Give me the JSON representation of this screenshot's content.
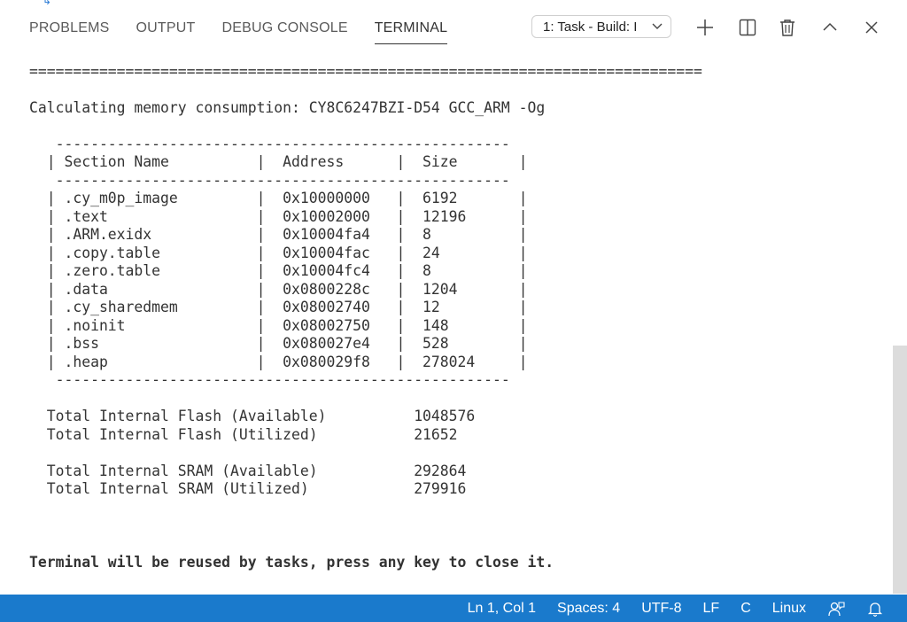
{
  "tabs": [
    {
      "label": "PROBLEMS"
    },
    {
      "label": "OUTPUT"
    },
    {
      "label": "DEBUG CONSOLE"
    },
    {
      "label": "TERMINAL"
    }
  ],
  "terminal_selector": {
    "value": "1: Task - Build: I"
  },
  "terminal_lines": [
    "=============================================================================",
    "Calculating memory consumption: CY8C6247BZI-D54 GCC_ARM -Og",
    "   ----------------------------------------------------",
    "  | Section Name          |  Address      |  Size       |",
    "   ----------------------------------------------------",
    "  | .cy_m0p_image         |  0x10000000   |  6192       |",
    "  | .text                 |  0x10002000   |  12196      |",
    "  | .ARM.exidx            |  0x10004fa4   |  8          |",
    "  | .copy.table           |  0x10004fac   |  24         |",
    "  | .zero.table           |  0x10004fc4   |  8          |",
    "  | .data                 |  0x0800228c   |  1204       |",
    "  | .cy_sharedmem         |  0x08002740   |  12         |",
    "  | .noinit               |  0x08002750   |  148        |",
    "  | .bss                  |  0x080027e4   |  528        |",
    "  | .heap                 |  0x080029f8   |  278024     |",
    "   ----------------------------------------------------",
    "  Total Internal Flash (Available)          1048576",
    "  Total Internal Flash (Utilized)           21652",
    "  Total Internal SRAM (Available)           292864",
    "  Total Internal SRAM (Utilized)            279916",
    "Terminal will be reused by tasks, press any key to close it."
  ],
  "status": {
    "position": "Ln 1, Col 1",
    "spaces": "Spaces: 4",
    "encoding": "UTF-8",
    "eol": "LF",
    "language": "C",
    "platform": "Linux"
  },
  "icons": {
    "add": "plus-icon",
    "split": "split-terminal-icon",
    "kill": "trash-icon",
    "maximize": "chevron-up-icon",
    "close": "close-icon",
    "feedback": "feedback-icon",
    "notifications": "bell-icon"
  },
  "colors": {
    "statusbar": "#1a7acc",
    "text": "#333333"
  }
}
